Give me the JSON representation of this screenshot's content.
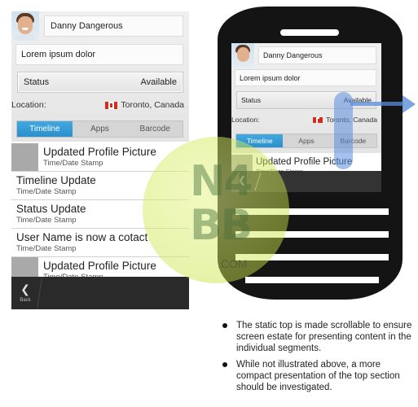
{
  "profile": {
    "name": "Danny Dangerous",
    "status_message": "Lorem ipsum dolor",
    "status_label": "Status",
    "status_value": "Available",
    "location_label": "Location:",
    "location_value": "Toronto, Canada",
    "location_flag": "canada-flag-icon"
  },
  "tabs": [
    {
      "label": "Timeline",
      "active": true
    },
    {
      "label": "Apps",
      "active": false
    },
    {
      "label": "Barcode",
      "active": false
    }
  ],
  "timeline": [
    {
      "title": "Updated Profile Picture",
      "stamp": "Time/Date Stamp",
      "has_picture": true
    },
    {
      "title": "Timeline Update",
      "stamp": "Time/Date Stamp",
      "has_picture": false
    },
    {
      "title": "Status Update",
      "stamp": "Time/Date Stamp",
      "has_picture": false
    },
    {
      "title": "User Name is now a cotact",
      "stamp": "Time/Date Stamp",
      "has_picture": false
    },
    {
      "title": "Updated Profile Picture",
      "stamp": "Time/Date Stamp",
      "has_picture": true
    }
  ],
  "actionbar": {
    "back_label": "Back",
    "back_icon": "chevron-left-icon"
  },
  "watermark": {
    "text": "N4BB",
    "suffix": ".COM"
  },
  "notes": [
    "The static top is made scrollable to ensure screen estate for presenting content in the individual segments.",
    "While not illustrated above, a more compact presentation of the top section should be investigated."
  ],
  "colors": {
    "tab_active": "#2b8fcb",
    "actionbar": "#2a2a2a",
    "phone_body": "#141414",
    "scroll_indicator": "#5a8cdc"
  }
}
